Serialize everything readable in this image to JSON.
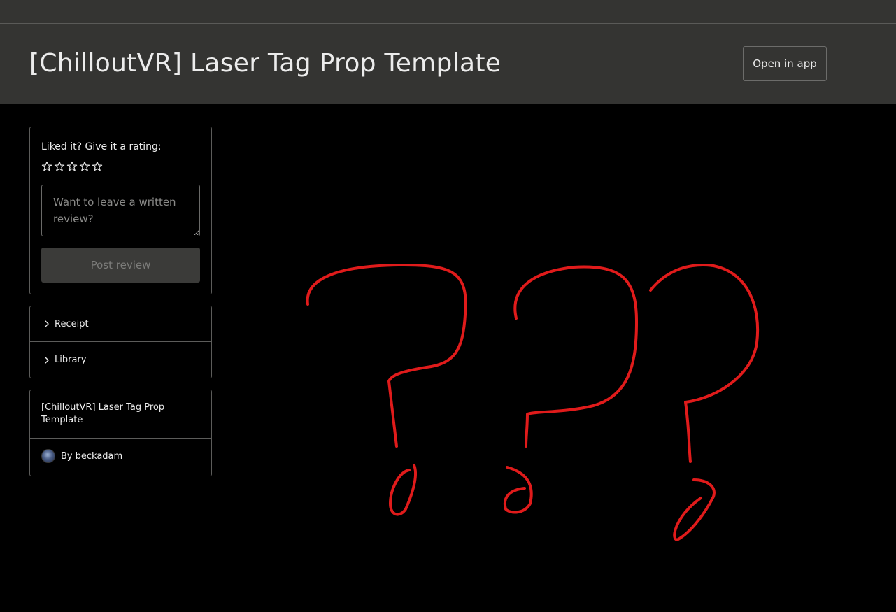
{
  "header": {
    "title": "[ChilloutVR] Laser Tag Prop Template",
    "open_app_label": "Open in app"
  },
  "rating": {
    "prompt": "Liked it? Give it a rating:",
    "star_count": 5,
    "selected_stars": 0,
    "review_placeholder": "Want to leave a written review?",
    "post_button_label": "Post review"
  },
  "accordion": {
    "items": [
      {
        "label": "Receipt",
        "icon": "chevron-right-icon"
      },
      {
        "label": "Library",
        "icon": "chevron-right-icon"
      }
    ]
  },
  "item_info": {
    "title": "[ChilloutVR] Laser Tag Prop Template",
    "by_label": "By",
    "author": "beckadam"
  },
  "preview": {
    "image": "red-question-marks-placeholder",
    "stroke_color": "#e01b1b"
  },
  "colors": {
    "header_bg": "#343432",
    "page_bg": "#000000",
    "border": "#5c5c5a",
    "disabled_button_bg": "#3b3b39"
  }
}
